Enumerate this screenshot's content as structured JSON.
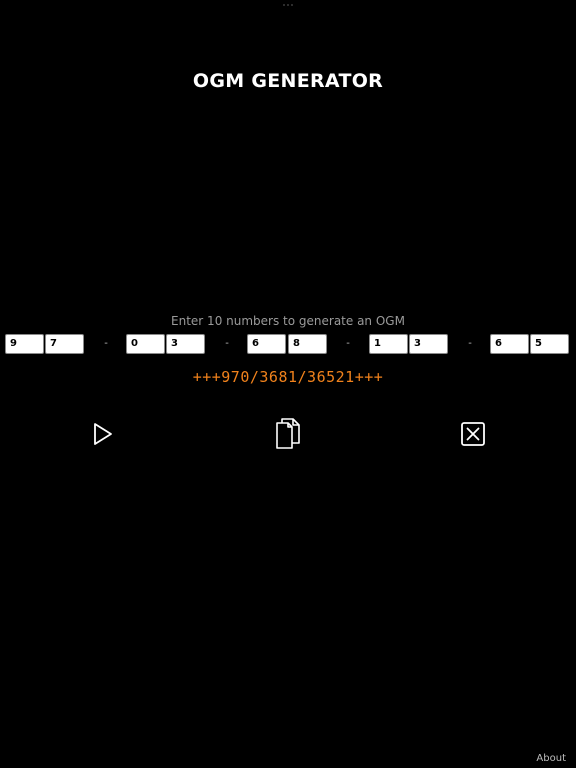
{
  "app": {
    "title": "OGM GENERATOR"
  },
  "form": {
    "instruction": "Enter 10 numbers to generate an OGM",
    "digits": [
      "9",
      "7",
      "0",
      "3",
      "6",
      "8",
      "1",
      "3",
      "6",
      "5"
    ],
    "separator": "-"
  },
  "result": {
    "ogm": "+++970/3681/36521+++",
    "color": "#f0821c"
  },
  "actions": [
    {
      "name": "generate",
      "icon": "play-icon"
    },
    {
      "name": "copy",
      "icon": "copy-icon"
    },
    {
      "name": "clear",
      "icon": "clear-icon"
    }
  ],
  "footer": {
    "about_label": "About"
  }
}
